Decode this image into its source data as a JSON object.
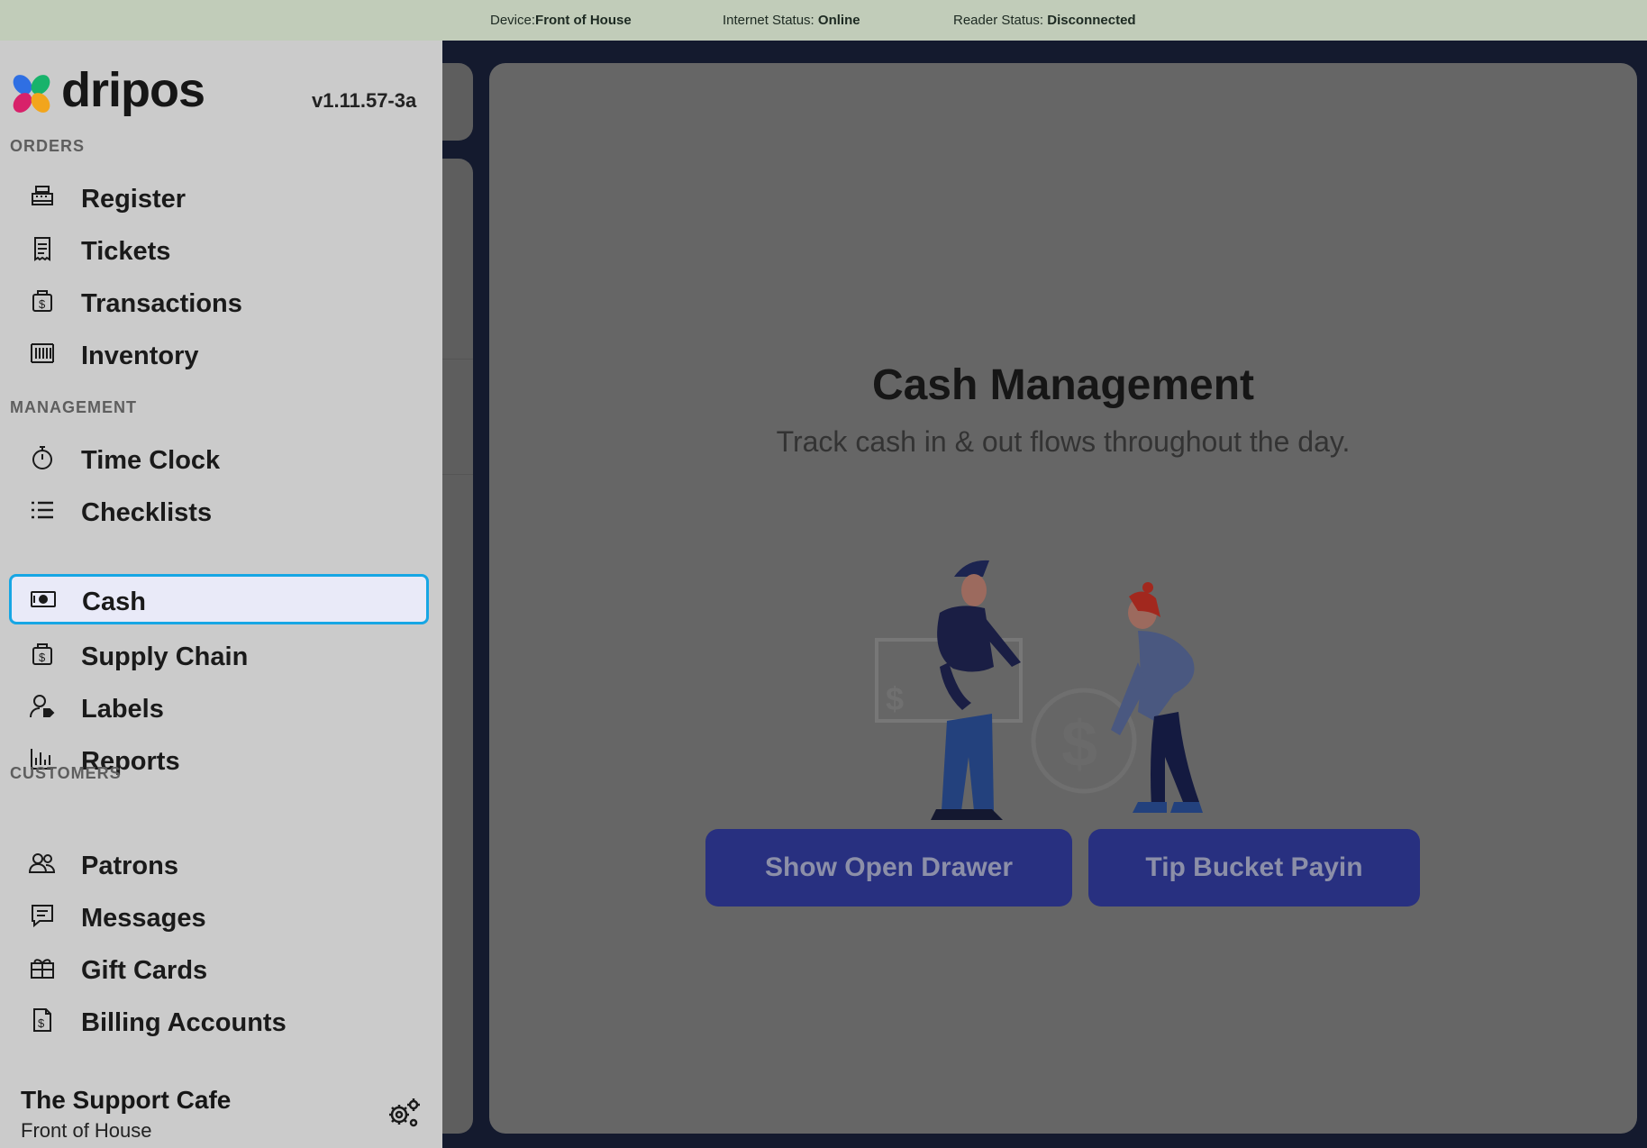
{
  "status_bar": {
    "device_label": "Device:",
    "device_value": "Front of House",
    "internet_label": "Internet Status: ",
    "internet_value": "Online",
    "reader_label": "Reader Status: ",
    "reader_value": "Disconnected"
  },
  "sidebar": {
    "brand": "dripos",
    "version": "v1.11.57-3a",
    "sections": {
      "orders": "ORDERS",
      "management": "MANAGEMENT",
      "customers": "CUSTOMERS"
    },
    "items": [
      {
        "label": "Register",
        "icon": "cash-register-icon"
      },
      {
        "label": "Tickets",
        "icon": "receipt-icon"
      },
      {
        "label": "Transactions",
        "icon": "dollar-bag-icon"
      },
      {
        "label": "Inventory",
        "icon": "barcode-icon"
      },
      {
        "label": "Time Clock",
        "icon": "stopwatch-icon"
      },
      {
        "label": "Checklists",
        "icon": "list-icon"
      },
      {
        "label": "Cash",
        "icon": "banknote-icon",
        "active": true
      },
      {
        "label": "Supply Chain",
        "icon": "dollar-bag-icon"
      },
      {
        "label": "Labels",
        "icon": "user-tag-icon"
      },
      {
        "label": "Reports",
        "icon": "bar-chart-icon"
      },
      {
        "label": "Patrons",
        "icon": "users-icon"
      },
      {
        "label": "Messages",
        "icon": "message-icon"
      },
      {
        "label": "Gift Cards",
        "icon": "gift-icon"
      },
      {
        "label": "Billing Accounts",
        "icon": "invoice-icon"
      }
    ],
    "store_name": "The Support Cafe",
    "store_location": "Front of House",
    "settings_icon": "gears-icon"
  },
  "main": {
    "title": "Cash Management",
    "subtitle": "Track cash in & out flows throughout the day.",
    "buttons": {
      "open_drawer": "Show Open Drawer",
      "tip_bucket": "Tip Bucket Payin"
    }
  },
  "colors": {
    "status_bar_bg": "#c1ccb9",
    "sidebar_bg": "#cbcbcb",
    "active_border": "#17a6e4",
    "active_bg": "#e9eaf8",
    "button_bg": "#283080",
    "overlay_bg": "#666666"
  }
}
